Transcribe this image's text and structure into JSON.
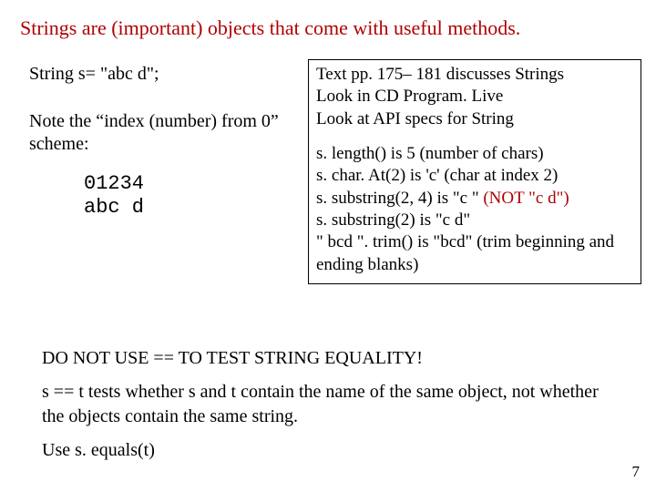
{
  "title": "Strings are (important) objects that come with useful methods.",
  "left": {
    "decl": "String s= \"abc d\";",
    "note": "Note the “index (number) from 0” scheme:",
    "idx_line1": "01234",
    "idx_line2": "abc d"
  },
  "box": {
    "line1": "Text pp. 175– 181 discusses Strings",
    "line2": "Look in CD Program. Live",
    "line3": "Look at API specs for String",
    "line4": "s. length()  is 5   (number of chars)",
    "line5": "s. char. At(2)   is 'c'  (char at index 2)",
    "line6a": "s. substring(2, 4)  is  \"c \"  ",
    "line6b": "(NOT  \"c d\")",
    "line7": "s. substring(2)    is  \"c d\"",
    "line8": "\"  bcd   \". trim()  is \"bcd\" (trim beginning and ending blanks)"
  },
  "bottom": {
    "warn": "DO NOT USE == TO TEST STRING EQUALITY!",
    "explain": "s == t tests whether s and t contain the name of the same object, not whether the objects contain the same string.",
    "use": "Use s. equals(t)"
  },
  "pagenum": "7"
}
